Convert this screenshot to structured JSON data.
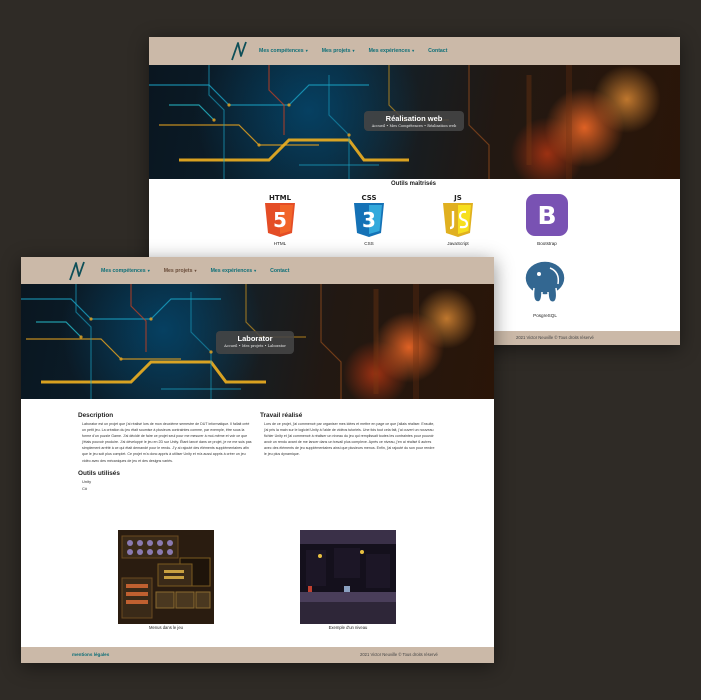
{
  "nav": {
    "items": [
      {
        "label": "Mes compétences"
      },
      {
        "label": "Mes projets"
      },
      {
        "label": "Mes expériences"
      },
      {
        "label": "Contact"
      }
    ]
  },
  "back": {
    "hero_title": "Réalisation web",
    "hero_crumb": "Accueil • Mes Compétences • Réalisation web",
    "tools_title": "Outils maîtrisés",
    "tools": [
      {
        "label": "HTML",
        "badge": "HTML",
        "digit": "5",
        "color": "#e44d26",
        "icon": "html5-icon"
      },
      {
        "label": "CSS",
        "badge": "CSS",
        "digit": "3",
        "color": "#2965f1",
        "icon": "css3-icon"
      },
      {
        "label": "JavaScript",
        "badge": "JS",
        "digit": "",
        "color": "#f0db4f",
        "icon": "js-icon"
      },
      {
        "label": "Bootstrap",
        "badge": "B",
        "digit": "",
        "color": "#7952b3",
        "icon": "bootstrap-icon"
      },
      {
        "label": "PosgreSQL",
        "badge": "",
        "digit": "",
        "color": "#336791",
        "icon": "postgresql-icon"
      }
    ],
    "footer": "2021 Victor Neuville © Tous droits réservé"
  },
  "front": {
    "hero_title": "Laborator",
    "hero_crumb": "Accueil • Mes projets • Laborator",
    "description_title": "Description",
    "description_text": "Laborator est un projet que j'ai réalisé lors de mon deuxième semestre de DUT informatique. Il fallait créé un petit jeu. La création du jeu était soumise à plusieurs contraintes comme, par exemple, être sous la forme d'un puzzle Game. J'ai décidé de faire ce projet seul pour me mesurer à moi-même et voir ce que j'étais pouvoir produire. J'ai développé le jeu en 2D sur Unity. Étant lancé dans ce projet, je ne me suis pas simplement arrêté à ce qui était demandé pour le rendu. J'y ai rajouté des éléments supplémentaires afin que le jeu soit plus complet. Ce projet m'a donc appris à utiliser Unity et m'a aussi appris à créer un jeu vidéo avec des mécaniques de jeu et des designs variés.",
    "work_title": "Travail réalisé",
    "work_text": "Lors de ce projet, j'ai commencé par organiser mes idées et mettre en page ce que j'allais réaliser. Ensuite, j'ai pris la main sur le logiciel Unity à l'aide de vidéos tutoriels. Une fois tout cela fait, j'ai ouvert un nouveau fichier Unity et j'ai commencé à réaliser un niveau du jeu qui remplissait toutes les contraintes pour pouvoir avoir un rendu avant de me lancer dans un travail plus complexe. Après ce niveau, j'en ai réalisé 6 autres avec des éléments de jeu supplémentaires ainsi que plusieurs menus. Enfin, j'ai rajouté du son pour rendre le jeu plus dynamique.",
    "tools_title": "Outils utilisés",
    "tools": [
      "Unity",
      "C#"
    ],
    "images": [
      {
        "caption": "Menus dans le jeu"
      },
      {
        "caption": "Exemple d'un niveau"
      }
    ],
    "footer_legal": "mentions légales",
    "footer_copy": "2021 Victor Neuville © Tous droits réservé"
  }
}
